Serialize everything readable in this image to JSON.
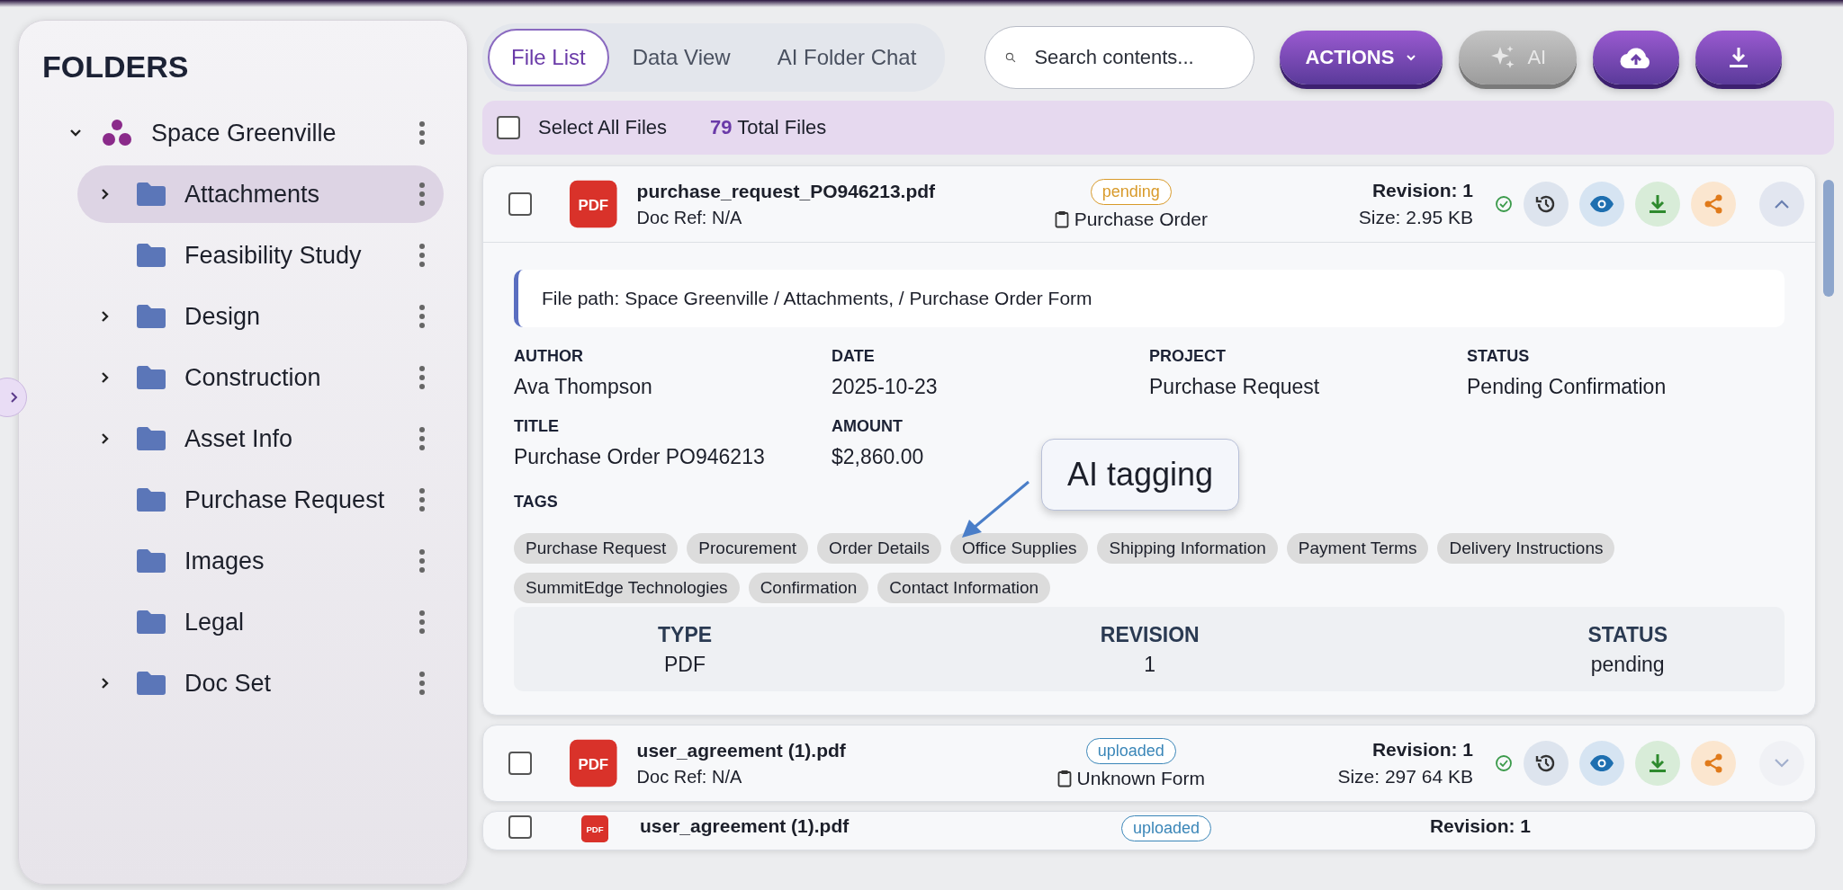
{
  "sidebar": {
    "title": "FOLDERS",
    "tree": [
      {
        "label": "Space Greenville",
        "kind": "project",
        "expanded": true,
        "has_children": true,
        "selected": false,
        "children": [
          {
            "label": "Attachments",
            "kind": "folder",
            "expanded": false,
            "has_children": true,
            "selected": true
          },
          {
            "label": "Feasibility Study",
            "kind": "folder",
            "has_children": false,
            "selected": false
          },
          {
            "label": "Design",
            "kind": "folder",
            "expanded": false,
            "has_children": true,
            "selected": false
          },
          {
            "label": "Construction",
            "kind": "folder",
            "expanded": false,
            "has_children": true,
            "selected": false
          },
          {
            "label": "Asset Info",
            "kind": "folder",
            "expanded": false,
            "has_children": true,
            "selected": false
          },
          {
            "label": "Purchase Request",
            "kind": "folder",
            "has_children": false,
            "selected": false
          },
          {
            "label": "Images",
            "kind": "folder",
            "has_children": false,
            "selected": false
          },
          {
            "label": "Legal",
            "kind": "folder",
            "has_children": false,
            "selected": false
          },
          {
            "label": "Doc Set",
            "kind": "folder",
            "expanded": false,
            "has_children": true,
            "selected": false
          }
        ]
      }
    ]
  },
  "toolbar": {
    "tabs": [
      {
        "label": "File List",
        "selected": true
      },
      {
        "label": "Data View",
        "selected": false
      },
      {
        "label": "AI Folder Chat",
        "selected": false
      }
    ],
    "search": {
      "placeholder": "Search contents..."
    },
    "actions_button": {
      "label": "ACTIONS"
    },
    "ai_button": {
      "label": "AI",
      "disabled": true
    }
  },
  "select_bar": {
    "label": "Select All Files",
    "checked": false,
    "count": "79",
    "count_label": "Total Files"
  },
  "files": [
    {
      "icon_label": "PDF",
      "name": "purchase_request_PO946213.pdf",
      "doc_ref": "Doc Ref: N/A",
      "status": "pending",
      "color": "#d89a2a",
      "form": "Purchase Order",
      "revision": "Revision: 1",
      "size": "Size: 2.95 KB",
      "checked": false,
      "expanded": true,
      "details": {
        "path": "File path: Space Greenville / Attachments, / Purchase Order Form",
        "fields": [
          {
            "label": "AUTHOR",
            "value": "Ava Thompson"
          },
          {
            "label": "DATE",
            "value": "2025-10-23"
          },
          {
            "label": "PROJECT",
            "value": "Purchase Request"
          },
          {
            "label": "STATUS",
            "value": "Pending Confirmation"
          },
          {
            "label": "TITLE",
            "value": "Purchase Order PO946213"
          },
          {
            "label": "AMOUNT",
            "value": "$2,860.00"
          }
        ],
        "tags_label": "TAGS",
        "tags": [
          "Purchase Request",
          "Procurement",
          "Order Details",
          "Office Supplies",
          "Shipping Information",
          "Payment Terms",
          "Delivery Instructions",
          "SummitEdge Technologies",
          "Confirmation",
          "Contact Information"
        ],
        "summary": [
          {
            "label": "TYPE",
            "value": "PDF"
          },
          {
            "label": "REVISION",
            "value": "1"
          },
          {
            "label": "STATUS",
            "value": "pending"
          }
        ],
        "callout": {
          "text": "AI tagging"
        }
      }
    },
    {
      "icon_label": "PDF",
      "name": "user_agreement (1).pdf",
      "doc_ref": "Doc Ref: N/A",
      "status": "uploaded",
      "color": "#3a86b8",
      "form": "Unknown Form",
      "revision": "Revision: 1",
      "size": "Size: 297 64 KB",
      "checked": false,
      "expanded": false
    },
    {
      "icon_label": "PDF",
      "name": "user_agreement (1).pdf",
      "status": "uploaded",
      "color": "#3a86b8",
      "revision": "Revision: 1",
      "checked": false
    }
  ]
}
